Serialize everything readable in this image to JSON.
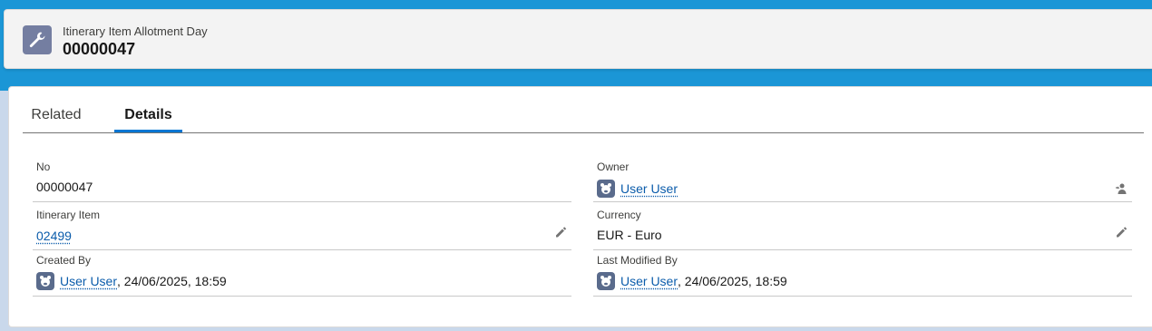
{
  "header": {
    "entity_label": "Itinerary Item Allotment Day",
    "record_title": "00000047",
    "icon": "wrench-icon",
    "icon_bg": "#747ea1"
  },
  "tabs": [
    {
      "label": "Related",
      "active": false
    },
    {
      "label": "Details",
      "active": true
    }
  ],
  "fields": {
    "no": {
      "label": "No",
      "value": "00000047"
    },
    "owner": {
      "label": "Owner",
      "value": "User User",
      "icon": "change-owner-icon"
    },
    "itinerary_item": {
      "label": "Itinerary Item",
      "value": "02499",
      "icon": "pencil-icon"
    },
    "currency": {
      "label": "Currency",
      "value": "EUR - Euro",
      "icon": "pencil-icon"
    },
    "created_by": {
      "label": "Created By",
      "user": "User User",
      "date": ", 24/06/2025, 18:59"
    },
    "last_modified_by": {
      "label": "Last Modified By",
      "user": "User User",
      "date": ", 24/06/2025, 18:59"
    }
  },
  "colors": {
    "accent": "#0176d3",
    "link": "#0b5cab",
    "background_band": "#1b96d6"
  }
}
